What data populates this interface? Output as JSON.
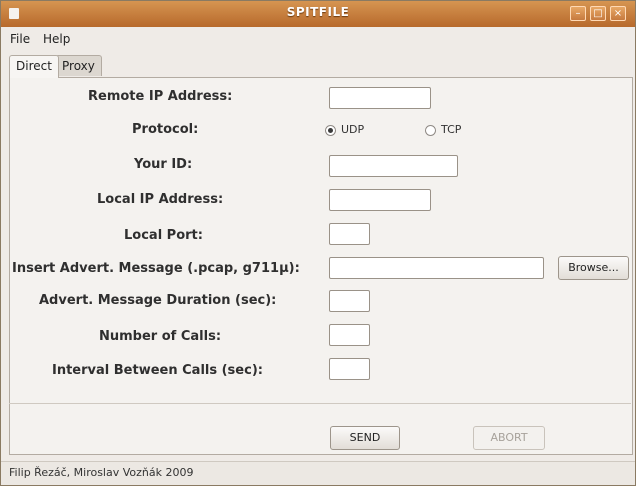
{
  "window": {
    "title": "SPITFILE",
    "controls": {
      "minimize": "–",
      "maximize": "□",
      "close": "×"
    }
  },
  "menu": [
    {
      "label": "File"
    },
    {
      "label": "Help"
    }
  ],
  "tabs": [
    {
      "label": "Direct",
      "active": true
    },
    {
      "label": "Proxy",
      "active": false
    }
  ],
  "form": {
    "remote_ip": {
      "label": "Remote IP Address:",
      "value": ""
    },
    "protocol": {
      "label": "Protocol:",
      "options": [
        {
          "label": "UDP",
          "selected": true
        },
        {
          "label": "TCP",
          "selected": false
        }
      ]
    },
    "your_id": {
      "label": "Your ID:",
      "value": ""
    },
    "local_ip": {
      "label": "Local IP Address:",
      "value": ""
    },
    "local_port": {
      "label": "Local Port:",
      "value": ""
    },
    "advert_message": {
      "label": "Insert Advert. Message (.pcap, g711µ):",
      "value": "",
      "browse_label": "Browse..."
    },
    "advert_duration": {
      "label": "Advert. Message Duration (sec):",
      "value": ""
    },
    "number_of_calls": {
      "label": "Number of Calls:",
      "value": ""
    },
    "interval": {
      "label": "Interval Between Calls (sec):",
      "value": ""
    }
  },
  "actions": {
    "send_label": "SEND",
    "abort_label": "ABORT"
  },
  "status": {
    "text": "Filip Řezáč, Miroslav Vozňák 2009"
  }
}
